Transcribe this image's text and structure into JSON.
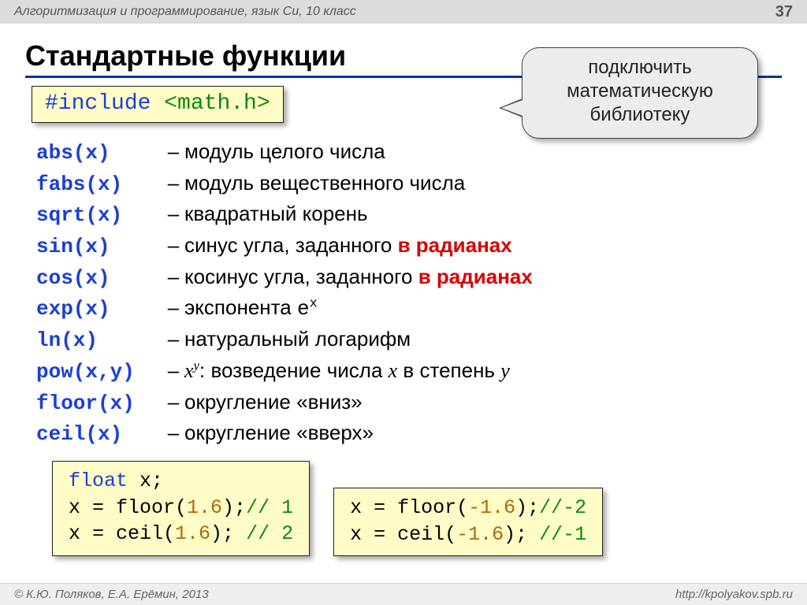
{
  "header": {
    "subject": "Алгоритмизация и программирование, язык Си, 10 класс",
    "page": "37"
  },
  "title": "Стандартные функции",
  "include": {
    "directive": "#include",
    "lib": "<math.h>"
  },
  "callout": {
    "l1": "подключить",
    "l2": "математическую",
    "l3": "библиотеку"
  },
  "funcs": [
    {
      "code": "abs(x)",
      "desc": "модуль целого числа"
    },
    {
      "code": "fabs(x)",
      "desc": "модуль вещественного числа"
    },
    {
      "code": "sqrt(x)",
      "desc": "квадратный корень"
    },
    {
      "code": "sin(x)",
      "desc": "синус угла, заданного ",
      "tail_red": "в радианах"
    },
    {
      "code": "cos(x)",
      "desc": "косинус угла, заданного ",
      "tail_red": "в радианах"
    },
    {
      "code": "exp(x)",
      "desc_pre": "экспонента ",
      "mono": "e",
      "sup": "x"
    },
    {
      "code": "ln(x)",
      "desc": "натуральный логарифм"
    },
    {
      "code": "pow(x,y)",
      "ital_base": "x",
      "ital_sup": "y",
      "desc_tail": ": возведение числа ",
      "x": "x",
      "mid": " в степень ",
      "y": "y"
    },
    {
      "code": "floor(x)",
      "desc": "округление «вниз»"
    },
    {
      "code": "ceil(x)",
      "desc": "округление «вверх»"
    }
  ],
  "dash": "–",
  "code1": {
    "decl_type": "float",
    "decl_rest": " x;",
    "l2a": "x = floor(",
    "l2n": "1.6",
    "l2b": ");",
    "l2c": "// 1",
    "l3a": "x = ceil(",
    "l3n": "1.6",
    "l3b": "); ",
    "l3c": "// 2"
  },
  "code2": {
    "l1a": "x = floor(",
    "l1n": "-1.6",
    "l1b": ");",
    "l1c": "//-2",
    "l2a": "x = ceil(",
    "l2n": "-1.6",
    "l2b": "); ",
    "l2c": "//-1"
  },
  "footer": {
    "left": "© К.Ю. Поляков, Е.А. Ерёмин, 2013",
    "right": "http://kpolyakov.spb.ru"
  }
}
